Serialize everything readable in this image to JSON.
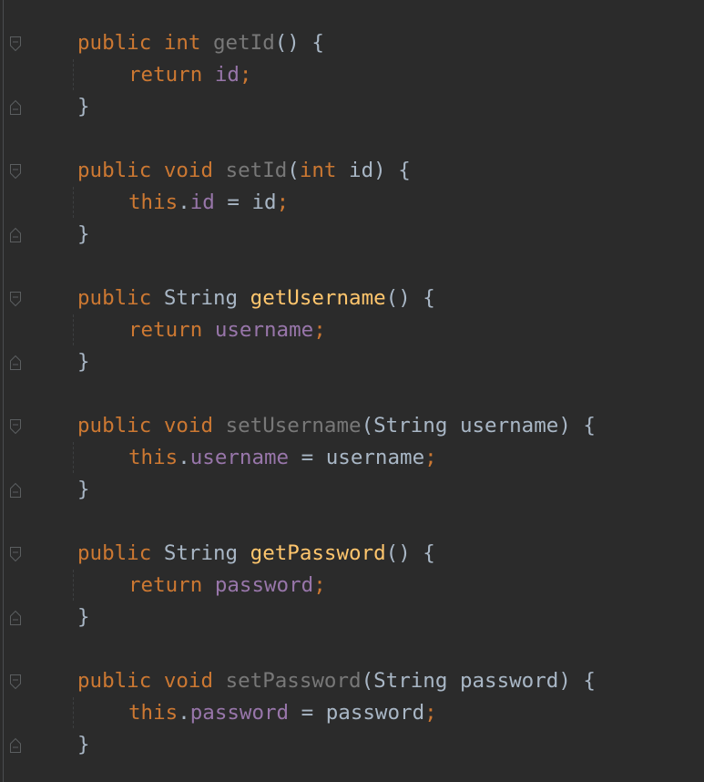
{
  "colors": {
    "background": "#2b2b2b",
    "keyword": "#cc7832",
    "plain": "#a9b7c6",
    "field": "#9876aa",
    "method_used": "#ffc66d",
    "method_unused": "#787878",
    "fold_marker": "#5b5e60"
  },
  "code": {
    "lines": [
      {
        "indent": 0,
        "tokens": [
          {
            "t": "public",
            "k": "keyword"
          },
          {
            "t": " ",
            "k": "plain"
          },
          {
            "t": "int",
            "k": "keyword"
          },
          {
            "t": " ",
            "k": "plain"
          },
          {
            "t": "getId",
            "k": "method_unused"
          },
          {
            "t": "() {",
            "k": "plain"
          }
        ],
        "fold": "open"
      },
      {
        "indent": 1,
        "tokens": [
          {
            "t": "return",
            "k": "keyword"
          },
          {
            "t": " ",
            "k": "plain"
          },
          {
            "t": "id",
            "k": "field"
          },
          {
            "t": ";",
            "k": "keyword"
          }
        ],
        "fold": "none"
      },
      {
        "indent": 0,
        "tokens": [
          {
            "t": "}",
            "k": "plain"
          }
        ],
        "fold": "close"
      },
      {
        "indent": 0,
        "tokens": [],
        "fold": "none"
      },
      {
        "indent": 0,
        "tokens": [
          {
            "t": "public",
            "k": "keyword"
          },
          {
            "t": " ",
            "k": "plain"
          },
          {
            "t": "void",
            "k": "keyword"
          },
          {
            "t": " ",
            "k": "plain"
          },
          {
            "t": "setId",
            "k": "method_unused"
          },
          {
            "t": "(",
            "k": "plain"
          },
          {
            "t": "int",
            "k": "keyword"
          },
          {
            "t": " id) {",
            "k": "plain"
          }
        ],
        "fold": "open"
      },
      {
        "indent": 1,
        "tokens": [
          {
            "t": "this",
            "k": "keyword"
          },
          {
            "t": ".",
            "k": "plain"
          },
          {
            "t": "id",
            "k": "field"
          },
          {
            "t": " = id",
            "k": "plain"
          },
          {
            "t": ";",
            "k": "keyword"
          }
        ],
        "fold": "none"
      },
      {
        "indent": 0,
        "tokens": [
          {
            "t": "}",
            "k": "plain"
          }
        ],
        "fold": "close"
      },
      {
        "indent": 0,
        "tokens": [],
        "fold": "none"
      },
      {
        "indent": 0,
        "tokens": [
          {
            "t": "public",
            "k": "keyword"
          },
          {
            "t": " String ",
            "k": "plain"
          },
          {
            "t": "getUsername",
            "k": "method_used"
          },
          {
            "t": "() {",
            "k": "plain"
          }
        ],
        "fold": "open"
      },
      {
        "indent": 1,
        "tokens": [
          {
            "t": "return",
            "k": "keyword"
          },
          {
            "t": " ",
            "k": "plain"
          },
          {
            "t": "username",
            "k": "field"
          },
          {
            "t": ";",
            "k": "keyword"
          }
        ],
        "fold": "none"
      },
      {
        "indent": 0,
        "tokens": [
          {
            "t": "}",
            "k": "plain"
          }
        ],
        "fold": "close"
      },
      {
        "indent": 0,
        "tokens": [],
        "fold": "none"
      },
      {
        "indent": 0,
        "tokens": [
          {
            "t": "public",
            "k": "keyword"
          },
          {
            "t": " ",
            "k": "plain"
          },
          {
            "t": "void",
            "k": "keyword"
          },
          {
            "t": " ",
            "k": "plain"
          },
          {
            "t": "setUsername",
            "k": "method_unused"
          },
          {
            "t": "(String username) {",
            "k": "plain"
          }
        ],
        "fold": "open"
      },
      {
        "indent": 1,
        "tokens": [
          {
            "t": "this",
            "k": "keyword"
          },
          {
            "t": ".",
            "k": "plain"
          },
          {
            "t": "username",
            "k": "field"
          },
          {
            "t": " = username",
            "k": "plain"
          },
          {
            "t": ";",
            "k": "keyword"
          }
        ],
        "fold": "none"
      },
      {
        "indent": 0,
        "tokens": [
          {
            "t": "}",
            "k": "plain"
          }
        ],
        "fold": "close"
      },
      {
        "indent": 0,
        "tokens": [],
        "fold": "none"
      },
      {
        "indent": 0,
        "tokens": [
          {
            "t": "public",
            "k": "keyword"
          },
          {
            "t": " String ",
            "k": "plain"
          },
          {
            "t": "getPassword",
            "k": "method_used"
          },
          {
            "t": "() {",
            "k": "plain"
          }
        ],
        "fold": "open"
      },
      {
        "indent": 1,
        "tokens": [
          {
            "t": "return",
            "k": "keyword"
          },
          {
            "t": " ",
            "k": "plain"
          },
          {
            "t": "password",
            "k": "field"
          },
          {
            "t": ";",
            "k": "keyword"
          }
        ],
        "fold": "none"
      },
      {
        "indent": 0,
        "tokens": [
          {
            "t": "}",
            "k": "plain"
          }
        ],
        "fold": "close"
      },
      {
        "indent": 0,
        "tokens": [],
        "fold": "none"
      },
      {
        "indent": 0,
        "tokens": [
          {
            "t": "public",
            "k": "keyword"
          },
          {
            "t": " ",
            "k": "plain"
          },
          {
            "t": "void",
            "k": "keyword"
          },
          {
            "t": " ",
            "k": "plain"
          },
          {
            "t": "setPassword",
            "k": "method_unused"
          },
          {
            "t": "(String password) {",
            "k": "plain"
          }
        ],
        "fold": "open"
      },
      {
        "indent": 1,
        "tokens": [
          {
            "t": "this",
            "k": "keyword"
          },
          {
            "t": ".",
            "k": "plain"
          },
          {
            "t": "password",
            "k": "field"
          },
          {
            "t": " = password",
            "k": "plain"
          },
          {
            "t": ";",
            "k": "keyword"
          }
        ],
        "fold": "none"
      },
      {
        "indent": 0,
        "tokens": [
          {
            "t": "}",
            "k": "plain"
          }
        ],
        "fold": "close"
      }
    ]
  }
}
